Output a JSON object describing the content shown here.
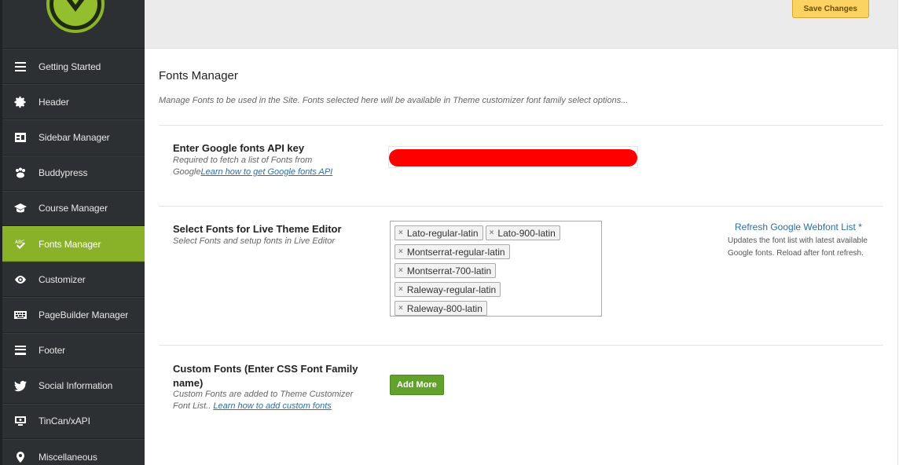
{
  "header": {
    "save_label": "Save Changes"
  },
  "sidebar": {
    "items": [
      {
        "label": "Getting Started",
        "icon": "menu-lines-icon"
      },
      {
        "label": "Header",
        "icon": "gear-icon"
      },
      {
        "label": "Sidebar Manager",
        "icon": "sidebar-layout-icon"
      },
      {
        "label": "Buddypress",
        "icon": "users-paw-icon"
      },
      {
        "label": "Course Manager",
        "icon": "graduation-cap-icon"
      },
      {
        "label": "Fonts Manager",
        "icon": "spellcheck-icon",
        "active": true
      },
      {
        "label": "Customizer",
        "icon": "eye-icon"
      },
      {
        "label": "PageBuilder Manager",
        "icon": "keyboard-icon"
      },
      {
        "label": "Footer",
        "icon": "footer-layout-icon"
      },
      {
        "label": "Social Information",
        "icon": "twitter-icon"
      },
      {
        "label": "TinCan/xAPI",
        "icon": "monitor-icon"
      },
      {
        "label": "Miscellaneous",
        "icon": "map-pin-icon"
      }
    ]
  },
  "main": {
    "title": "Fonts Manager",
    "subtitle": "Manage Fonts to be used in the Site. Fonts selected here will be available in Theme customizer font family select options...",
    "api": {
      "label": "Enter Google fonts API key",
      "desc": "Required to fetch a list of Fonts from Google",
      "link": "Learn how to get Google fonts API"
    },
    "live_fonts": {
      "label": "Select Fonts for Live Theme Editor",
      "desc": "Select Fonts and setup fonts in Live Editor",
      "tags": [
        "Lato-regular-latin",
        "Lato-900-latin",
        "Montserrat-regular-latin",
        "Montserrat-700-latin",
        "Raleway-regular-latin",
        "Raleway-800-latin"
      ],
      "remove_symbol": "×",
      "refresh_link": "Refresh Google Webfont List",
      "refresh_marker": "*",
      "refresh_desc": "Updates the font list with latest available Google fonts. Reload after font refresh."
    },
    "custom": {
      "label": "Custom Fonts (Enter CSS Font Family name)",
      "desc": "Custom Fonts are added to Theme Customizer Font List..",
      "link": "Learn how to add custom fonts",
      "button": "Add More"
    }
  },
  "colors": {
    "sidebar_bg": "#2d3033",
    "active_item": "#8ab229",
    "save_button": "#fcd262",
    "add_button": "#62a12c",
    "link": "#2a6fa8",
    "redaction": "#ff0000"
  }
}
